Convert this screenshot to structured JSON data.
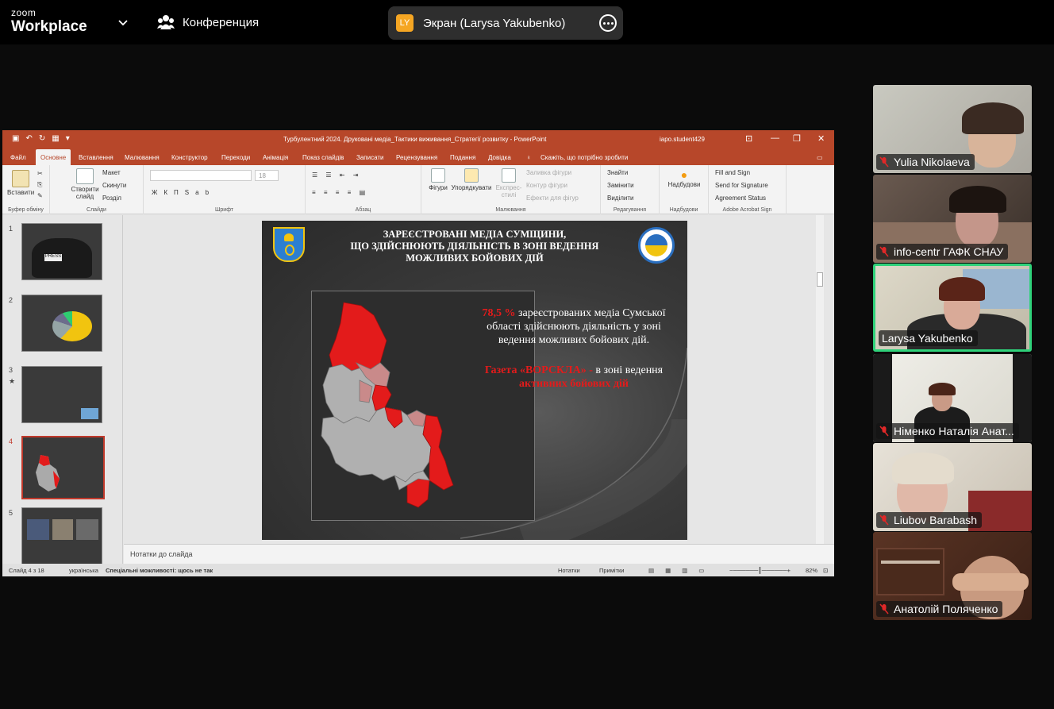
{
  "zoom": {
    "brand_top": "zoom",
    "brand_bottom": "Workplace",
    "meeting_label": "Конференция",
    "share_badge": "LY",
    "share_label": "Экран (Larysa Yakubenko)"
  },
  "ppt": {
    "window_title": "Турбулентний 2024. Друковані медіа_Тактики виживання_Стратегії розвитку - PowerPoint",
    "user": "iapo.student429",
    "tabs": [
      "Файл",
      "Основне",
      "Вставлення",
      "Малювання",
      "Конструктор",
      "Переходи",
      "Анімація",
      "Показ слайдів",
      "Записати",
      "Рецензування",
      "Подання",
      "Довідка"
    ],
    "tell_me": "Скажіть, що потрібно зробити",
    "ribbon": {
      "paste": "Вставити",
      "clipboard": "Буфер обміну",
      "new_slide": "Створити слайд",
      "layout": "Макет",
      "reset": "Скинути",
      "section": "Розділ",
      "slides": "Слайди",
      "font": "Шрифт",
      "font_size": "18",
      "paragraph": "Абзац",
      "shapes": "Фігури",
      "arrange": "Упорядкувати",
      "quick_styles": "Експрес-стилі",
      "shape_fill": "Заливка фігури",
      "shape_outline": "Контур фігури",
      "shape_effects": "Ефекти для фігур",
      "drawing": "Малювання",
      "find": "Знайти",
      "replace": "Замінити",
      "select": "Виділити",
      "editing": "Редагування",
      "designer": "Надбудови",
      "addins": "Надбудови",
      "fill_sign": "Fill and Sign",
      "send_sign": "Send for Signature",
      "agreement": "Agreement Status",
      "acrobat": "Adobe Acrobat Sign"
    },
    "thumb_numbers": [
      "1",
      "2",
      "3",
      "4",
      "5"
    ],
    "thumb_mark": "★",
    "slide": {
      "title_l1": "ЗАРЕЄСТРОВАНІ МЕДІА СУМЩИНИ,",
      "title_l2": "ЩО ЗДІЙСНЮЮТЬ ДІЯЛЬНІСТЬ В ЗОНІ ВЕДЕННЯ",
      "title_l3": "МОЖЛИВИХ БОЙОВИХ ДІЙ",
      "pct": "78,5 %",
      "text1": " зареєстрованих медіа Сумської області здійснюють діяльність у зоні ведення можливих бойових дій.",
      "paper": "Газета «ВОРСКЛА» -",
      "text2": " в зоні ведення ",
      "text2_red": "активних бойових дій"
    },
    "notes_placeholder": "Нотатки до слайда",
    "status": {
      "slide_count": "Слайд 4 з 18",
      "language": "українська",
      "accessibility": "Спеціальні можливості: щось не так",
      "notes": "Нотатки",
      "comments": "Примітки",
      "zoom": "82%"
    },
    "accent": "#b7472a"
  },
  "participants": [
    {
      "name": "Yulia  Nikolaeva",
      "muted": true
    },
    {
      "name": "info-centr ГАФК СНАУ",
      "muted": true
    },
    {
      "name": "Larysa Yakubenko",
      "muted": false,
      "speaking": true
    },
    {
      "name": "Німенко Наталія Анат...",
      "muted": true
    },
    {
      "name": "Liubov Barabash",
      "muted": true
    },
    {
      "name": "Анатолій Поляченко",
      "muted": true
    }
  ]
}
